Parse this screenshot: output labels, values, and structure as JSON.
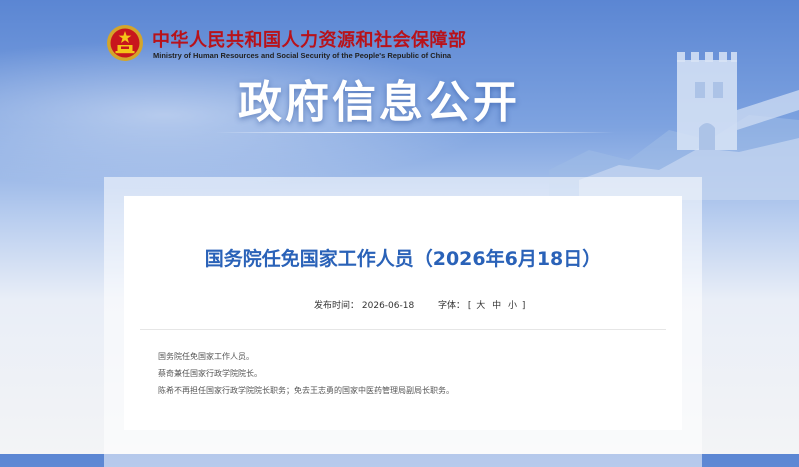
{
  "header": {
    "site_title": "中华人民共和国人力资源和社会保障部",
    "site_subtitle": "Ministry of Human Resources and Social Security of the People's Republic of China",
    "section_title": "政府信息公开",
    "emblem_icon": "national-emblem-icon",
    "accent_color": "#b8121a"
  },
  "article": {
    "title": "国务院任免国家工作人员（2026年6月18日）",
    "publish_label": "发布时间：",
    "publish_date": "2026-06-18",
    "font_label": "字体：",
    "font_bracket_open": "[",
    "font_sizes": [
      "大",
      "中",
      "小"
    ],
    "font_bracket_close": "]",
    "paragraphs": [
      "国务院任免国家工作人员。",
      "蔡奇兼任国家行政学院院长。",
      "陈希不再担任国家行政学院院长职务；免去王志勇的国家中医药管理局副局长职务。"
    ],
    "title_color": "#2a62b8"
  }
}
